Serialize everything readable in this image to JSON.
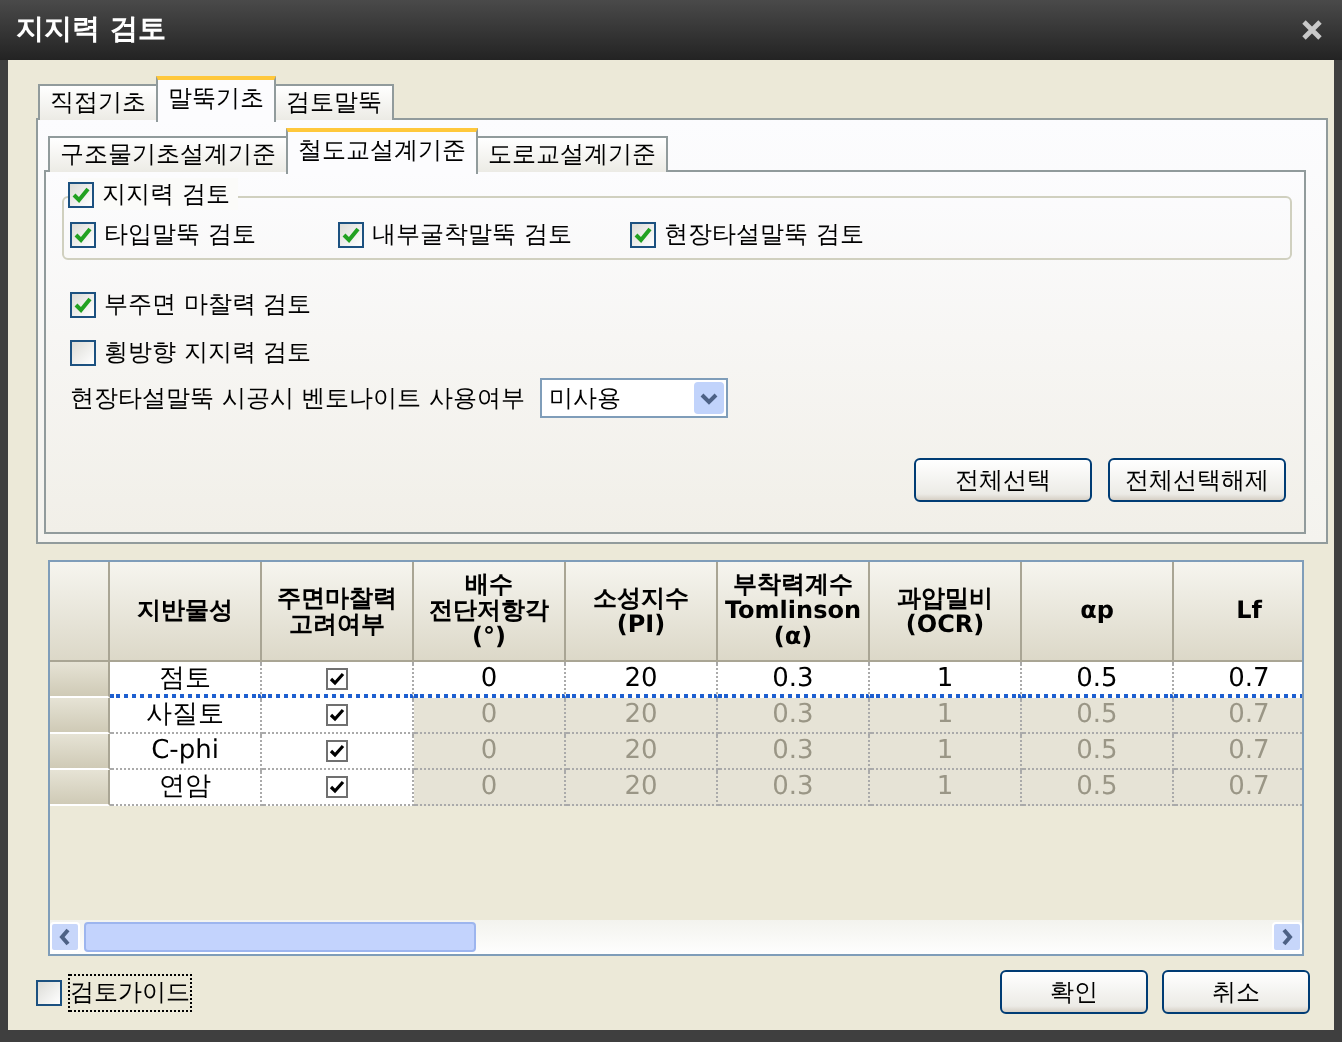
{
  "window": {
    "title": "지지력 검토"
  },
  "outer_tabs": [
    {
      "label": "직접기초",
      "selected": false
    },
    {
      "label": "말뚝기초",
      "selected": true
    },
    {
      "label": "검토말뚝",
      "selected": false
    }
  ],
  "inner_tabs": [
    {
      "label": "구조물기초설계기준",
      "selected": false
    },
    {
      "label": "철도교설계기준",
      "selected": true
    },
    {
      "label": "도로교설계기준",
      "selected": false
    }
  ],
  "bearing_check": {
    "label": "지지력 검토",
    "checked": true,
    "options": [
      {
        "label": "타입말뚝 검토",
        "checked": true
      },
      {
        "label": "내부굴착말뚝 검토",
        "checked": true
      },
      {
        "label": "현장타설말뚝 검토",
        "checked": true
      }
    ]
  },
  "options": [
    {
      "label": "부주면 마찰력 검토",
      "checked": true
    },
    {
      "label": "횡방향 지지력 검토",
      "checked": false
    }
  ],
  "bentonite": {
    "label": "현장타설말뚝 시공시 벤토나이트 사용여부",
    "value": "미사용"
  },
  "panel_buttons": [
    "전체선택",
    "전체선택해제"
  ],
  "grid": {
    "columns": [
      "지반물성",
      "주면마찰력\n고려여부",
      "배수\n전단저항각\n(°)",
      "소성지수\n(PI)",
      "부착력계수\nTomlinson\n(α)",
      "과압밀비\n(OCR)",
      "αp",
      "Lf"
    ],
    "rows": [
      {
        "material": "점토",
        "friction": true,
        "values": [
          "0",
          "20",
          "0.3",
          "1",
          "0.5",
          "0.7"
        ],
        "disabled": false,
        "focused": true
      },
      {
        "material": "사질토",
        "friction": true,
        "values": [
          "0",
          "20",
          "0.3",
          "1",
          "0.5",
          "0.7"
        ],
        "disabled": true,
        "focused": false
      },
      {
        "material": "C-phi",
        "friction": true,
        "values": [
          "0",
          "20",
          "0.3",
          "1",
          "0.5",
          "0.7"
        ],
        "disabled": true,
        "focused": false
      },
      {
        "material": "연암",
        "friction": true,
        "values": [
          "0",
          "20",
          "0.3",
          "1",
          "0.5",
          "0.7"
        ],
        "disabled": true,
        "focused": false
      }
    ]
  },
  "guide": {
    "label": "검토가이드",
    "checked": false
  },
  "buttons": [
    "확인",
    "취소"
  ]
}
